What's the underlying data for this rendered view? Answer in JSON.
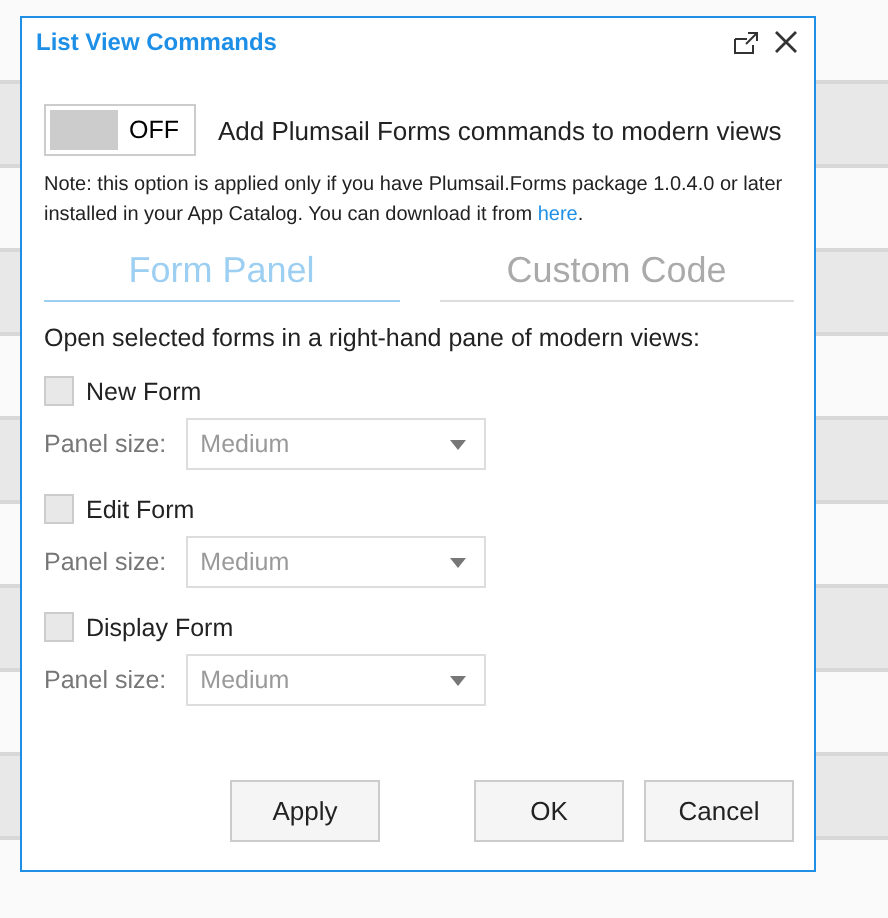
{
  "window": {
    "title": "List View Commands"
  },
  "toggle": {
    "on": false,
    "state_label": "OFF",
    "label": "Add Plumsail Forms commands to modern views"
  },
  "note": {
    "text": "Note: this option is applied only if you have Plumsail.Forms package 1.0.4.0 or later installed in your App Catalog. You can download it from ",
    "link": "here",
    "after": "."
  },
  "tabs": [
    {
      "label": "Form Panel",
      "selected": true
    },
    {
      "label": "Custom Code",
      "selected": false
    }
  ],
  "intro": "Open selected forms in a right-hand pane of modern views:",
  "forms": [
    {
      "label": "New Form",
      "checked": false,
      "size_label": "Panel size:",
      "size": "Medium",
      "disabled": true
    },
    {
      "label": "Edit Form",
      "checked": false,
      "size_label": "Panel size:",
      "size": "Medium",
      "disabled": true
    },
    {
      "label": "Display Form",
      "checked": false,
      "size_label": "Panel size:",
      "size": "Medium",
      "disabled": true
    }
  ],
  "buttons": {
    "left": [
      "Apply"
    ],
    "right": [
      "OK",
      "Cancel"
    ]
  }
}
